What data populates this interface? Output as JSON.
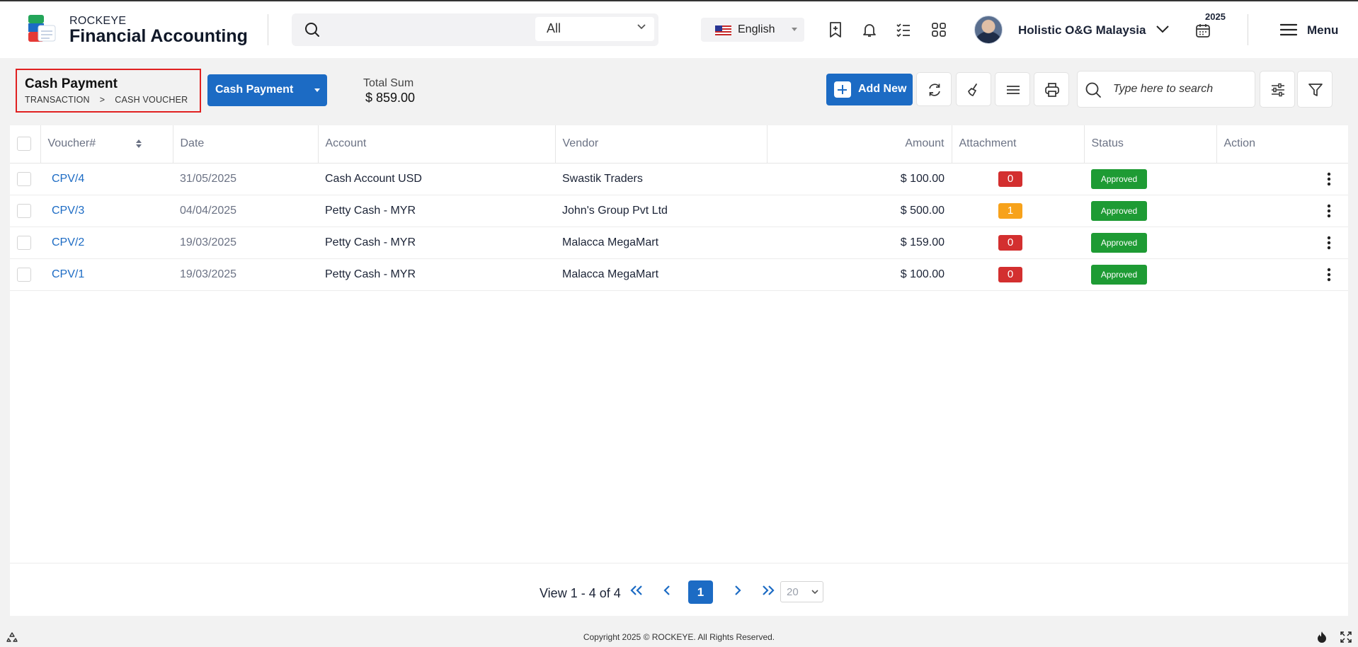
{
  "header": {
    "brand_top": "ROCKEYE",
    "brand_main": "Financial Accounting",
    "search_scope": "All",
    "language": "English",
    "company": "Holistic O&G Malaysia",
    "year": "2025",
    "menu_label": "Menu"
  },
  "page": {
    "title": "Cash Payment",
    "breadcrumb": [
      "TRANSACTION",
      ">",
      "CASH VOUCHER"
    ],
    "type_selector": "Cash Payment",
    "total_label": "Total Sum",
    "total_value": "$ 859.00",
    "add_new_label": "Add New",
    "search_placeholder": "Type here to search"
  },
  "table": {
    "columns": [
      "Voucher#",
      "Date",
      "Account",
      "Vendor",
      "Amount",
      "Attachment",
      "Status",
      "Action"
    ],
    "rows": [
      {
        "voucher": "CPV/4",
        "date": "31/05/2025",
        "account": "Cash Account USD",
        "vendor": "Swastik Traders",
        "amount": "$ 100.00",
        "attachment": "0",
        "status": "Approved"
      },
      {
        "voucher": "CPV/3",
        "date": "04/04/2025",
        "account": "Petty Cash - MYR",
        "vendor": "John's Group Pvt Ltd",
        "amount": "$ 500.00",
        "attachment": "1",
        "status": "Approved"
      },
      {
        "voucher": "CPV/2",
        "date": "19/03/2025",
        "account": "Petty Cash - MYR",
        "vendor": "Malacca MegaMart",
        "amount": "$ 159.00",
        "attachment": "0",
        "status": "Approved"
      },
      {
        "voucher": "CPV/1",
        "date": "19/03/2025",
        "account": "Petty Cash - MYR",
        "vendor": "Malacca MegaMart",
        "amount": "$ 100.00",
        "attachment": "0",
        "status": "Approved"
      }
    ]
  },
  "colors": {
    "primary": "#1c6bc4",
    "approved": "#1e9b34",
    "attachment_zero": "#d32f2f",
    "attachment_nonzero": "#f7a21b"
  },
  "pagination": {
    "summary": "View 1 - 4 of 4",
    "current_page": "1",
    "page_size": "20"
  },
  "footer": {
    "copyright": "Copyright 2025 © ROCKEYE. All Rights Reserved."
  }
}
